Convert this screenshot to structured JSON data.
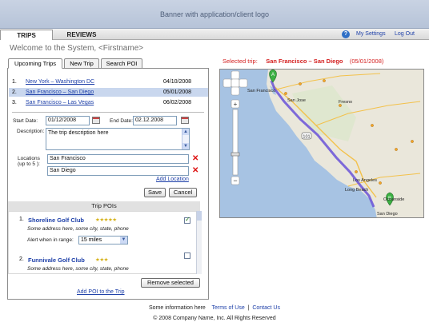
{
  "banner": {
    "text": "Banner with application/client logo"
  },
  "nav": {
    "tabs": [
      {
        "label": "TRIPS"
      },
      {
        "label": "REVIEWS"
      }
    ],
    "help_icon": "question-icon",
    "my_settings": "My Settings",
    "log_out": "Log Out"
  },
  "welcome": "Welcome to the System, <Firstname>",
  "selected_trip": {
    "label": "Selected trip:",
    "name": "San Francisco – San Diego",
    "date": "(05/01/2008)"
  },
  "trips_tabs": [
    {
      "label": "Upcoming Trips"
    },
    {
      "label": "New Trip"
    },
    {
      "label": "Search POI"
    }
  ],
  "trips": [
    {
      "num": "1.",
      "name": "New York – Washington DC",
      "date": "04/10/2008"
    },
    {
      "num": "2.",
      "name": "San Francisco – San Diego",
      "date": "05/01/2008"
    },
    {
      "num": "3.",
      "name": "San Francisco – Las Vegas",
      "date": "06/02/2008"
    }
  ],
  "form": {
    "start_label": "Start Date:",
    "start_value": "01/12/2008",
    "end_label": "End Date:",
    "end_value": "02.12.2008",
    "description_label": "Description:",
    "description_value": "The trip description here",
    "locations_label": "Locations",
    "locations_sub": "(up to 5 ):",
    "locations": [
      "San Francisco",
      "San Diego"
    ],
    "add_location": "Add Location",
    "save": "Save",
    "cancel": "Cancel"
  },
  "pois": {
    "header": "Trip POIs",
    "items": [
      {
        "num": "1.",
        "name": "Shoreline Golf Club",
        "stars": "★★★★★",
        "address": "Some address here, some city, state, phone",
        "checked": true
      },
      {
        "num": "2.",
        "name": "Funnivale Golf Club",
        "stars": "★★★",
        "address": "Some address here, some city, state, phone",
        "checked": false
      }
    ],
    "alert_label": "Alert when in range:",
    "alert_value": "15 miles",
    "remove_selected": "Remove selected",
    "add_poi": "Add POI to the Trip"
  },
  "map": {
    "labels": {
      "san_francisco": "San Francisco",
      "san_jose": "San Jose",
      "fresno": "Fresno",
      "los_angeles": "Los Angeles",
      "long_beach": "Long Beach",
      "oceanside": "Oceanside",
      "san_diego": "San Diego",
      "highway": "101",
      "marker_a": "A",
      "marker_b": "B"
    },
    "route_color": "#6a52d8",
    "water_color": "#a7c3e3",
    "land_color": "#eae7db"
  },
  "footer": {
    "info": "Some information here",
    "terms": "Terms of Use",
    "separator": "|",
    "contact": "Contact Us",
    "copyright": "© 2008 Company Name, Inc. All Rights Reserved"
  }
}
